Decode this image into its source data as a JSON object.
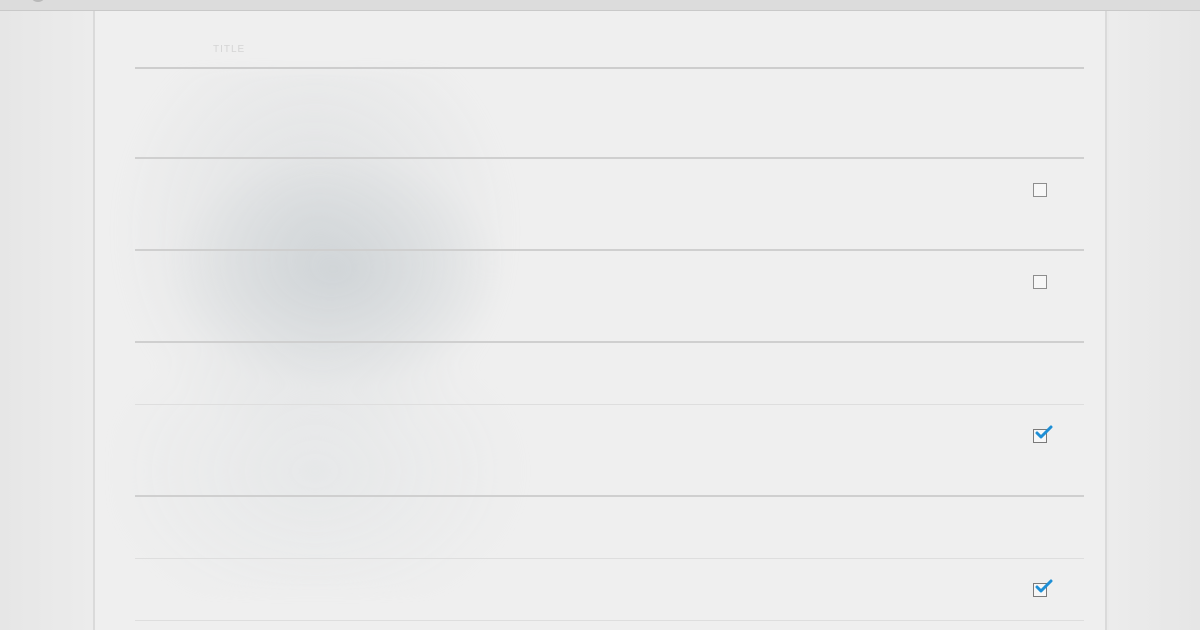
{
  "panel": {
    "title": "TITLE"
  },
  "rows": [
    {
      "id": "row-1",
      "label": "",
      "has_checkbox": false
    },
    {
      "id": "row-2",
      "label": "",
      "has_checkbox": true,
      "checked": false
    },
    {
      "id": "row-3",
      "label": "",
      "has_checkbox": true,
      "checked": false
    },
    {
      "id": "row-4",
      "label": "",
      "has_checkbox": false
    },
    {
      "id": "row-5",
      "label": "",
      "has_checkbox": true,
      "checked": true
    },
    {
      "id": "row-6",
      "label": "",
      "has_checkbox": false
    },
    {
      "id": "row-7",
      "label": "",
      "has_checkbox": true,
      "checked": true
    }
  ],
  "colors": {
    "check_accent": "#1e8fd6",
    "checkbox_border": "#8d8d8d",
    "divider": "#cfcfcf"
  },
  "icons": {
    "checked": "checkmark-icon"
  }
}
